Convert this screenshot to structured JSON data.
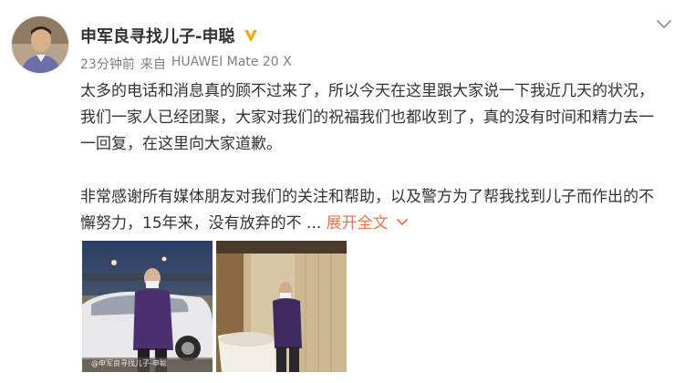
{
  "post": {
    "author_name": "申军良寻找儿子-申聪",
    "time": "23分钟前",
    "source_prefix": "来自",
    "device": "HUAWEI Mate 20 X",
    "paragraph1": "太多的电话和消息真的顾不过来了，所以今天在这里跟大家说一下我近几天的状况，我们一家人已经团聚，大家对我们的祝福我们也都收到了，真的没有时间和精力去一一回复，在这里向大家道歉。",
    "paragraph2": "非常感谢所有媒体朋友对我们的关注和帮助，以及警方为了帮我找到儿子而作出的不懈努力，15年来，没有放弃的不 ...",
    "expand_label": "展开全文",
    "photo_watermark": "@申军良寻找儿子-申聪"
  },
  "icons": {
    "verified": "verified-badge-icon",
    "menu": "chevron-down-icon",
    "expand": "chevron-down-icon"
  },
  "colors": {
    "text": "#333333",
    "meta": "#808080",
    "link": "#eb7350",
    "verified": "#ffa500"
  }
}
